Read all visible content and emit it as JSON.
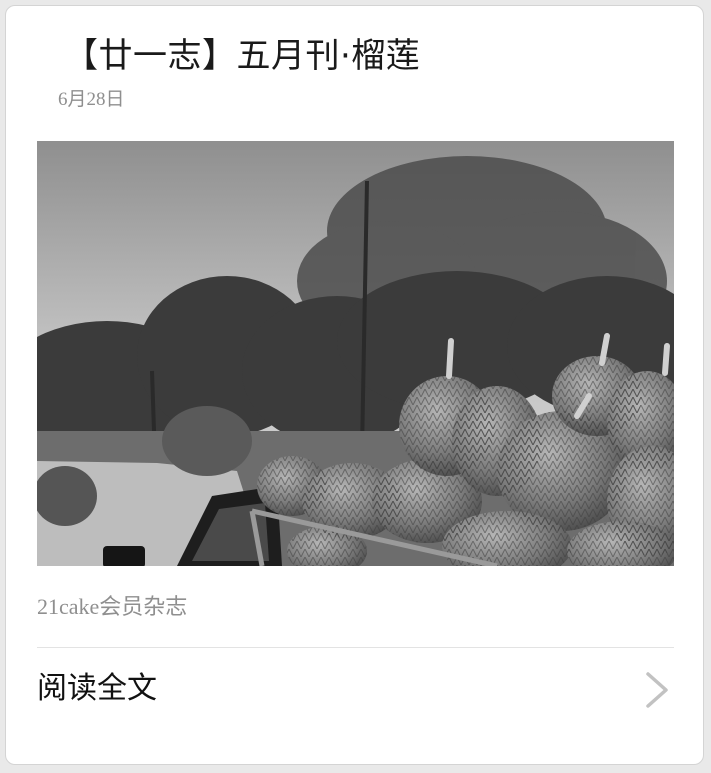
{
  "article": {
    "title": "【廿一志】五月刊·榴莲",
    "date": "6月28日",
    "account": "21cake会员杂志",
    "cover_image": "durian-truck-photo"
  },
  "footer": {
    "read_label": "阅读全文",
    "chevron_icon": "chevron-right-icon"
  },
  "colors": {
    "card_bg": "#ffffff",
    "page_bg": "#e9e9e9",
    "title": "#1a1a1a",
    "meta": "#8f8f8f",
    "divider": "#e3e3e3",
    "chevron": "#c2c2c2"
  }
}
